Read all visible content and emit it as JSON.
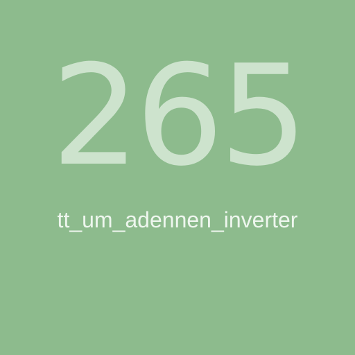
{
  "tile": {
    "number": "265",
    "caption": "tt_um_adennen_inverter",
    "background_color": "#8DBB8D",
    "number_color": "#CDE3CD",
    "caption_color": "#EEF6EE"
  }
}
